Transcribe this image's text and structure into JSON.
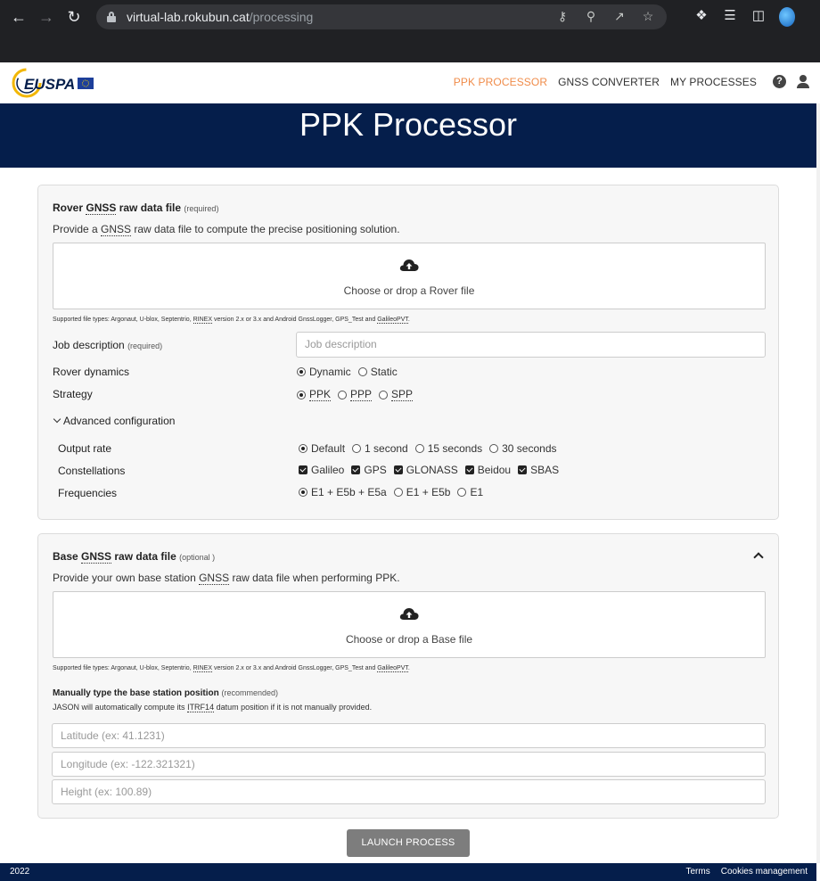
{
  "browser": {
    "url_host": "virtual-lab.rokubun.cat",
    "url_path": "/processing"
  },
  "brand": {
    "logo_text": "EUSPA"
  },
  "nav": {
    "items": [
      "PPK PROCESSOR",
      "GNSS CONVERTER",
      "MY PROCESSES"
    ],
    "help": "?"
  },
  "hero": {
    "title": "PPK Processor"
  },
  "rover": {
    "title_a": "Rover ",
    "title_gnss": "GNSS",
    "title_b": " raw data file",
    "required": "(required)",
    "desc_a": "Provide a ",
    "desc_gnss": "GNSS",
    "desc_b": " raw data file to compute the precise positioning solution.",
    "drop_text": "Choose or drop a Rover file",
    "supported_a": "Supported file types: Argonaut, U-blox, Septentrio, ",
    "supported_rinex": "RINEX",
    "supported_b": " version 2.x or 3.x and Android GnssLogger, GPS_Test and ",
    "supported_galileo": "GalileoPVT",
    "supported_end": "."
  },
  "job": {
    "label": "Job description",
    "required": "(required)",
    "placeholder": "Job description"
  },
  "dynamics": {
    "label": "Rover dynamics",
    "options": [
      "Dynamic",
      "Static"
    ],
    "selected": "Dynamic"
  },
  "strategy": {
    "label": "Strategy",
    "options": [
      "PPK",
      "PPP",
      "SPP"
    ],
    "selected": "PPK"
  },
  "advanced": {
    "label": "Advanced configuration",
    "output_rate": {
      "label": "Output rate",
      "options": [
        "Default",
        "1 second",
        "15 seconds",
        "30 seconds"
      ],
      "selected": "Default"
    },
    "constellations": {
      "label": "Constellations",
      "options": [
        "Galileo",
        "GPS",
        "GLONASS",
        "Beidou",
        "SBAS"
      ],
      "checked": [
        true,
        true,
        true,
        true,
        true
      ]
    },
    "frequencies": {
      "label": "Frequencies",
      "options": [
        "E1 + E5b + E5a",
        "E1 + E5b",
        "E1"
      ],
      "selected": "E1 + E5b + E5a"
    }
  },
  "base": {
    "title_a": "Base ",
    "title_gnss": "GNSS",
    "title_b": " raw data file",
    "optional": "(optional )",
    "desc_a": "Provide your own base station ",
    "desc_gnss": "GNSS",
    "desc_b": " raw data file when performing PPK.",
    "drop_text": "Choose or drop a Base file",
    "position_title": "Manually type the base station position",
    "recommended": "(recommended)",
    "position_desc_a": "JASON will automatically compute its ",
    "position_desc_itrf": "ITRF14",
    "position_desc_b": " datum position if it is not manually provided.",
    "latitude_placeholder": "Latitude (ex: 41.1231)",
    "longitude_placeholder": "Longitude (ex: -122.321321)",
    "height_placeholder": "Height (ex: 100.89)"
  },
  "launch_label": "LAUNCH PROCESS",
  "footer": {
    "year": "2022",
    "terms": "Terms",
    "cookies": "Cookies management"
  },
  "colors": {
    "navy": "#051e4b",
    "accent": "#f08c4a",
    "button": "#7d7d7d"
  }
}
